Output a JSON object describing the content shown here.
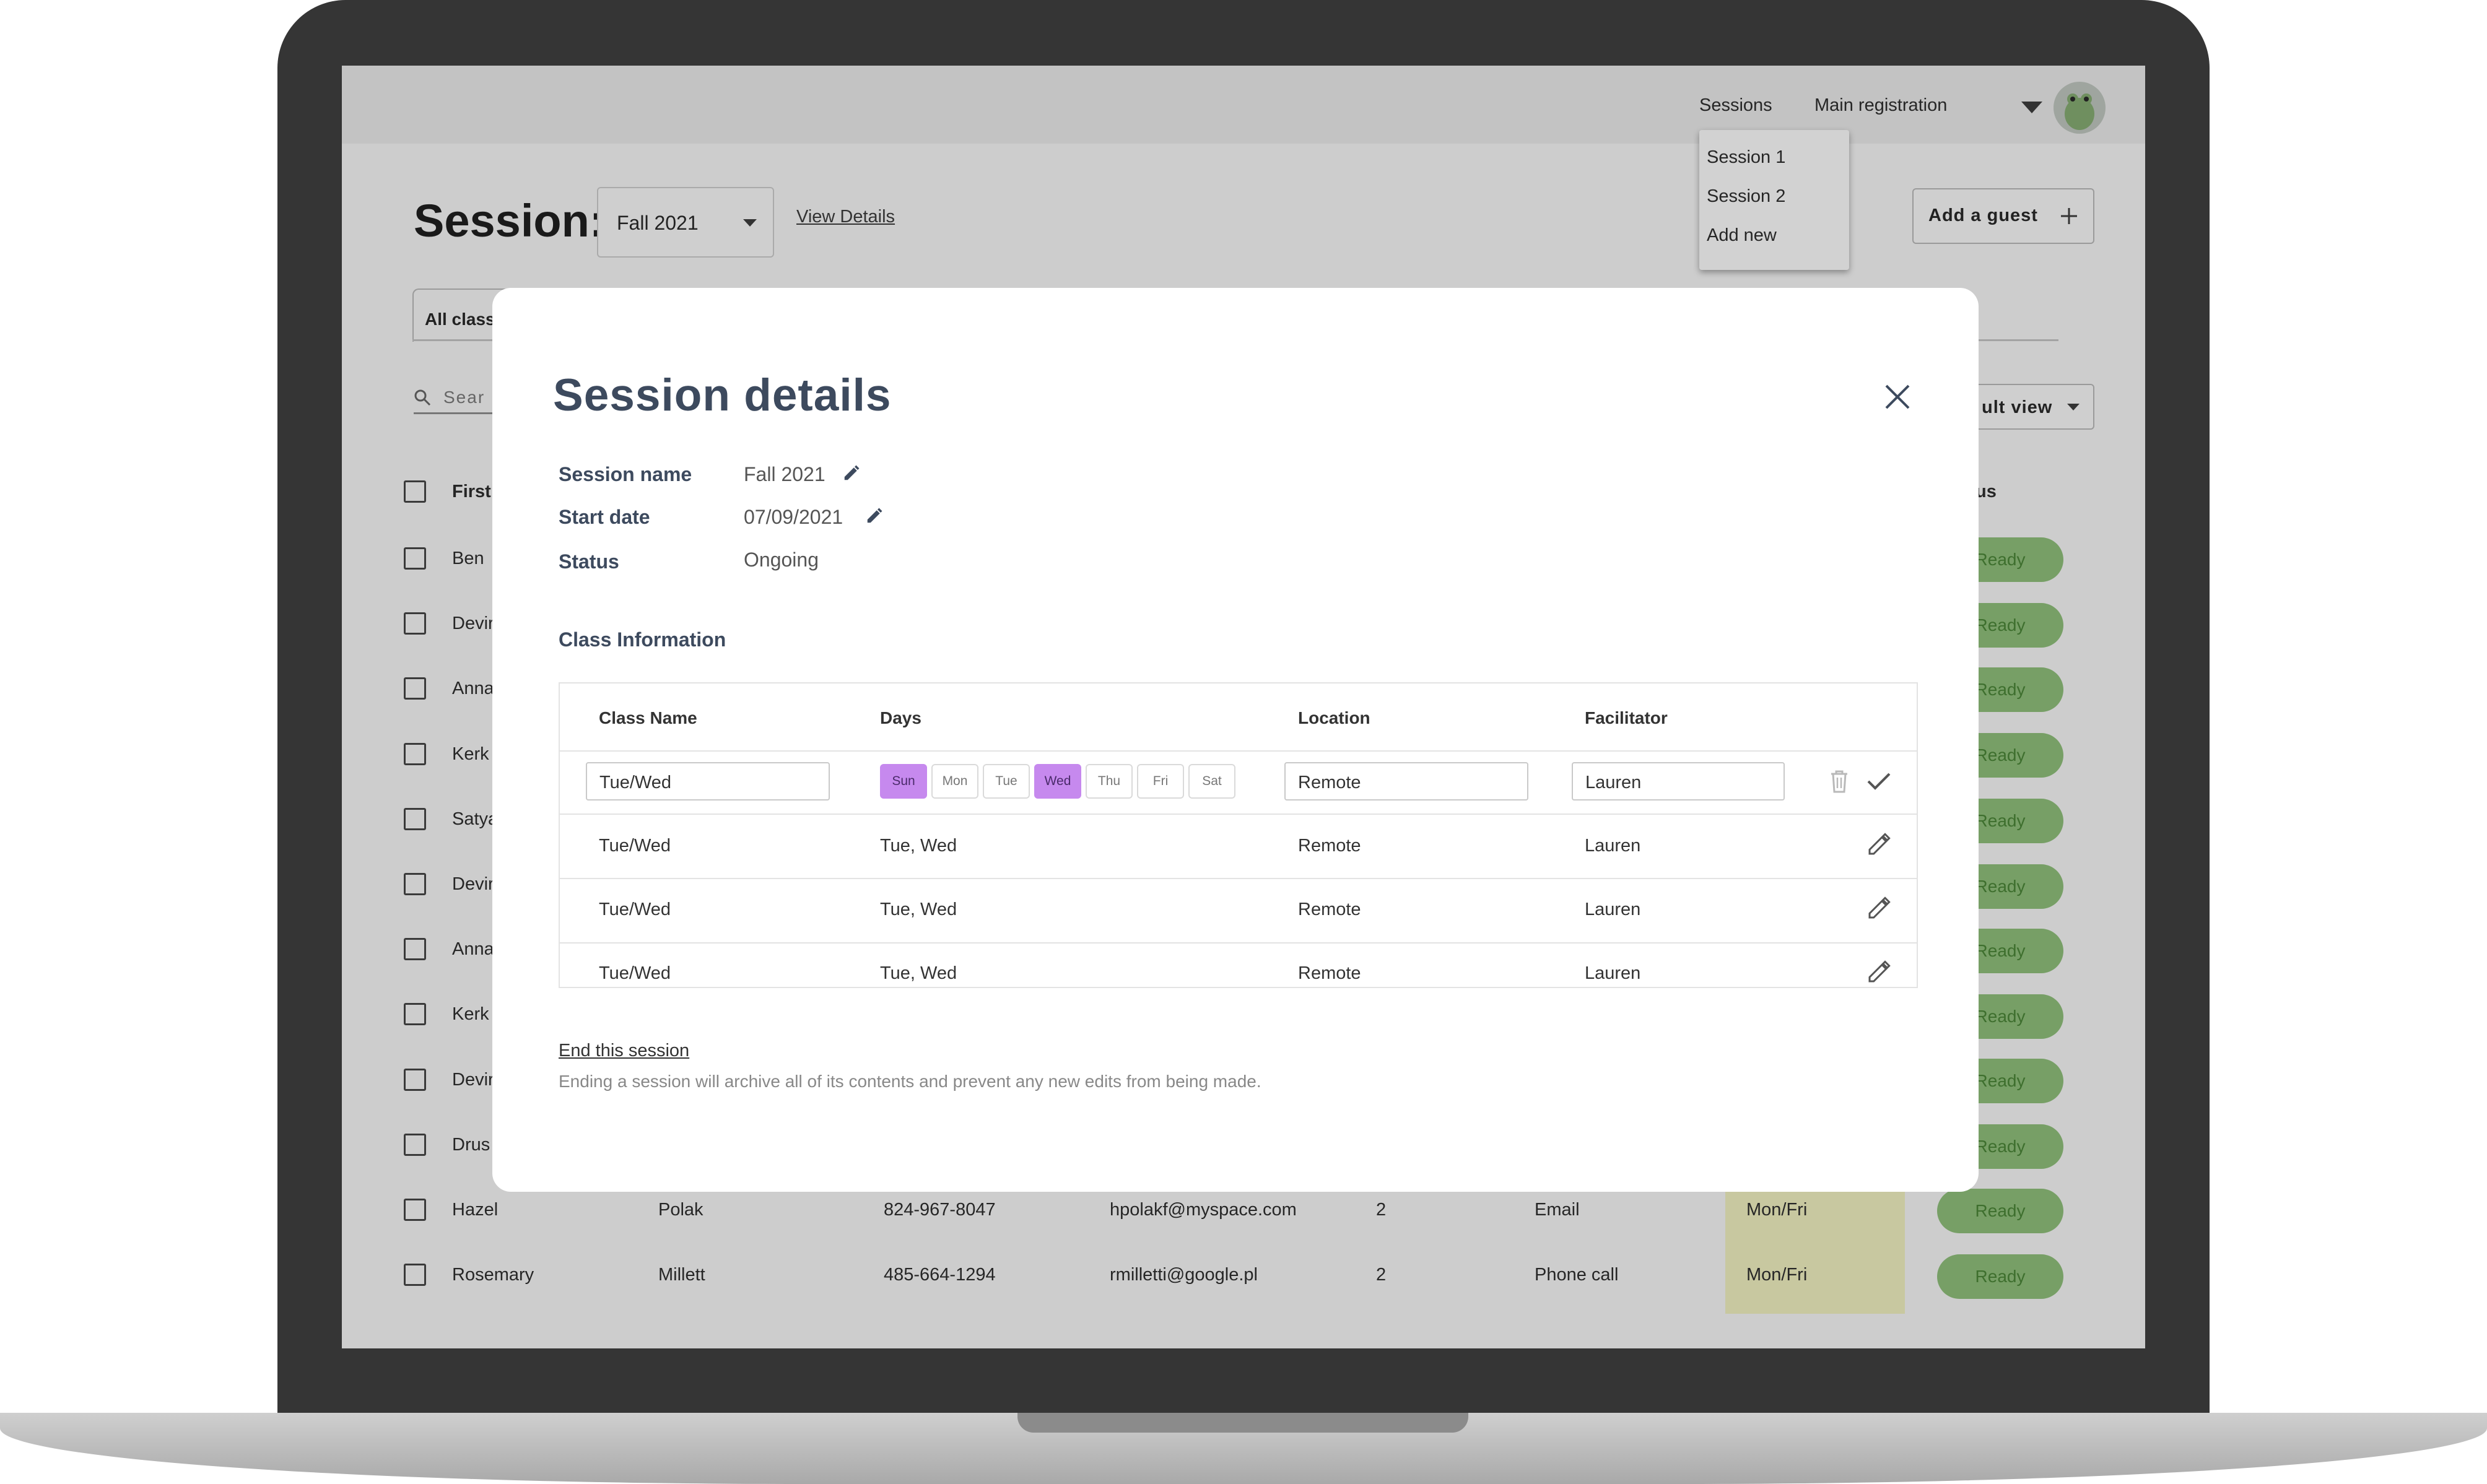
{
  "top_nav": {
    "sessions_label": "Sessions",
    "registration_label": "Main registration"
  },
  "sessions_menu": {
    "items": [
      "Session 1",
      "Session 2",
      "Add new"
    ]
  },
  "page": {
    "title": "Session:",
    "session_select_value": "Fall 2021",
    "view_details_link": "View Details",
    "add_guest_label": "Add a guest",
    "tab_label": "All class",
    "search_placeholder": "Sear",
    "view_select_label": "ult view",
    "col_first": "First",
    "col_status": "us"
  },
  "background_rows": [
    {
      "first": "Ben",
      "status": "Ready"
    },
    {
      "first": "Devir",
      "status": "Ready"
    },
    {
      "first": "Anna",
      "status": "Ready"
    },
    {
      "first": "Kerk",
      "status": "Ready"
    },
    {
      "first": "Satya",
      "status": "Ready"
    },
    {
      "first": "Devir",
      "status": "Ready"
    },
    {
      "first": "Anna",
      "status": "Ready"
    },
    {
      "first": "Kerk",
      "status": "Ready"
    },
    {
      "first": "Devir",
      "status": "Ready"
    },
    {
      "first": "Drus",
      "status": "Ready"
    },
    {
      "first": "Hazel",
      "last": "Polak",
      "phone": "824-967-8047",
      "email": "hpolakf@myspace.com",
      "count": "2",
      "contact": "Email",
      "days": "Mon/Fri",
      "status": "Ready"
    },
    {
      "first": "Rosemary",
      "last": "Millett",
      "phone": "485-664-1294",
      "email": "rmilletti@google.pl",
      "count": "2",
      "contact": "Phone call",
      "days": "Mon/Fri",
      "status": "Ready"
    }
  ],
  "modal": {
    "title": "Session details",
    "fields": [
      {
        "label": "Session name",
        "value": "Fall 2021"
      },
      {
        "label": "Start date",
        "value": "07/09/2021"
      },
      {
        "label": "Status",
        "value": "Ongoing"
      }
    ],
    "class_info_title": "Class Information",
    "table": {
      "headers": [
        "Class Name",
        "Days",
        "Location",
        "Facilitator"
      ],
      "edit_row": {
        "class_name": "Tue/Wed",
        "location": "Remote",
        "facilitator": "Lauren",
        "days": [
          {
            "label": "Sun",
            "selected": true
          },
          {
            "label": "Mon",
            "selected": false
          },
          {
            "label": "Tue",
            "selected": false
          },
          {
            "label": "Wed",
            "selected": true
          },
          {
            "label": "Thu",
            "selected": false
          },
          {
            "label": "Fri",
            "selected": false
          },
          {
            "label": "Sat",
            "selected": false
          }
        ]
      },
      "rows": [
        {
          "class_name": "Tue/Wed",
          "days": "Tue, Wed",
          "location": "Remote",
          "facilitator": "Lauren"
        },
        {
          "class_name": "Tue/Wed",
          "days": "Tue, Wed",
          "location": "Remote",
          "facilitator": "Lauren"
        },
        {
          "class_name": "Tue/Wed",
          "days": "Tue, Wed",
          "location": "Remote",
          "facilitator": "Lauren"
        }
      ]
    },
    "end_session_link": "End this session",
    "end_session_note": "Ending a session will archive all of its contents and prevent any new edits from being made."
  },
  "colors": {
    "modal_heading": "#3d4a5e",
    "ready_pill": "#779f66",
    "day_selected": "#c689ee",
    "overlay_bg": "#cdcdcd"
  }
}
